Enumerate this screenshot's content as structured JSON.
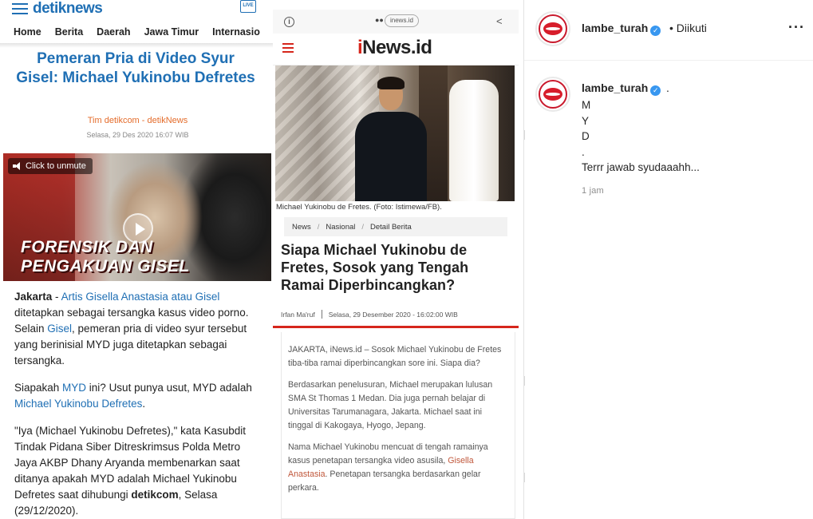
{
  "detik": {
    "logo_a": "detik",
    "logo_b": "news",
    "live_label": "LIVE",
    "nav": [
      "Home",
      "Berita",
      "Daerah",
      "Jawa Timur",
      "Internasio"
    ],
    "headline": "Pemeran Pria di Video Syur Gisel: Michael Yukinobu Defretes",
    "author": "Tim detikcom - detikNews",
    "date": "Selasa, 29 Des 2020 16:07 WIB",
    "video": {
      "unmute_label": "Click to unmute",
      "caption_line1": "FORENSIK DAN",
      "caption_line2": "PENGAKUAN GISEL"
    },
    "p1": {
      "lead": "Jakarta",
      "dash": " - ",
      "link1": "Artis Gisella Anastasia atau Gisel",
      "text1": " ditetapkan sebagai tersangka kasus video porno. Selain ",
      "link2": "Gisel",
      "text2": ", pemeran pria di video syur tersebut yang berinisial MYD juga ditetapkan sebagai tersangka."
    },
    "p2": {
      "text1": "Siapakah ",
      "link1": "MYD",
      "text2": " ini? Usut punya usut, MYD adalah ",
      "link2": "Michael Yukinobu Defretes",
      "text3": "."
    },
    "p3": {
      "text1": "\"Iya (Michael Yukinobu Defretes),\" kata Kasubdit Tindak Pidana Siber Ditreskrimsus Polda Metro Jaya AKBP Dhany Aryanda membenarkan saat ditanya apakah MYD adalah Michael Yukinobu Defretes saat dihubungi ",
      "bold": "detikcom",
      "text2": ", Selasa (29/12/2020)."
    }
  },
  "inews": {
    "url": "inews.id",
    "dots": "●●",
    "logo_i": "i",
    "logo_rest": "News.id",
    "photo_caption": "Michael Yukinobu de Fretes. (Foto: Istimewa/FB).",
    "crumbs": [
      "News",
      "Nasional",
      "Detail Berita"
    ],
    "title": "Siapa Michael Yukinobu de Fretes, Sosok yang Tengah Ramai Diperbincangkan?",
    "author": "Irfan Ma'ruf",
    "date": "Selasa, 29 Desember 2020 - 16:02:00 WIB",
    "p1": "JAKARTA, iNews.id – Sosok Michael Yukinobu de Fretes tiba-tiba ramai diperbincangkan sore ini. Siapa dia?",
    "p2": "Berdasarkan penelusuran, Michael merupakan lulusan SMA St Thomas 1 Medan. Dia juga pernah belajar di Universitas Tarumanagara, Jakarta. Michael saat ini tinggal di Kakogaya, Hyogo, Jepang.",
    "p3": {
      "text1": "Nama Michael Yukinobu mencuat di tengah ramainya kasus penetapan tersangka video asusila, ",
      "link": "Gisella Anastasia",
      "text2": ". Penetapan tersangka berdasarkan gelar perkara."
    }
  },
  "instagram": {
    "username": "lambe_turah",
    "follow_status": "• Diikuti",
    "more_label": "···",
    "caption_dot": ".",
    "caption_lines": [
      "M",
      "Y",
      "D",
      ".",
      "Terrr jawab syudaaahh..."
    ],
    "time": "1 jam",
    "verified_mark": "✓",
    "colors": {
      "verified": "#3897f0",
      "accent_red": "#d71d2b"
    }
  },
  "colors": {
    "detik_blue": "#1f6fb4",
    "detik_orange": "#e46c2b",
    "inews_red": "#d6261c"
  }
}
